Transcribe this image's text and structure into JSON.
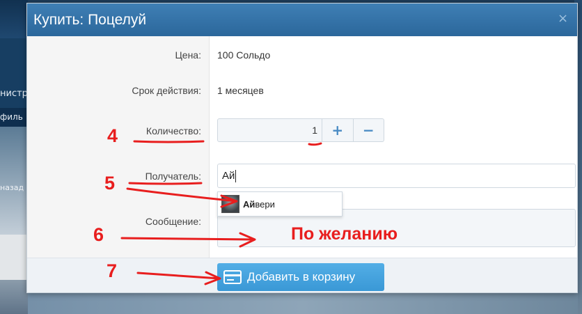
{
  "background": {
    "left_texts": [
      "нистр",
      "филь",
      "назад"
    ]
  },
  "modal": {
    "title": "Купить: Поцелуй",
    "close_glyph": "×",
    "fields": {
      "price_label": "Цена:",
      "price_value": "100 Сольдо",
      "duration_label": "Срок действия:",
      "duration_value": "1 месяцев",
      "quantity_label": "Количество:",
      "quantity_value": "1",
      "plus_glyph": "+",
      "minus_glyph": "−",
      "recipient_label": "Получатель:",
      "recipient_value": "Ай",
      "message_label": "Сообщение:"
    },
    "suggestion": {
      "match": "Ай",
      "rest": "вери"
    },
    "add_button_label": "Добавить в корзину"
  },
  "annotations": {
    "n4": "4",
    "n5": "5",
    "n6": "6",
    "n7": "7",
    "optional_text": "По желанию",
    "color": "#e81e1e"
  }
}
